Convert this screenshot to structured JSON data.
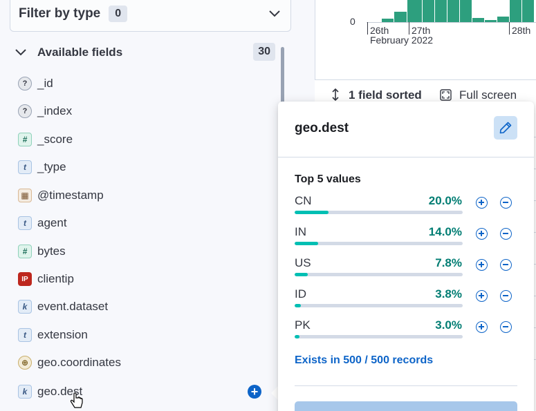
{
  "sidebar": {
    "filter": {
      "label": "Filter by type",
      "count": "0"
    },
    "available": {
      "title": "Available fields",
      "count": "30"
    },
    "fields": [
      {
        "name": "_id",
        "type": "unknown",
        "icon_text": "?"
      },
      {
        "name": "_index",
        "type": "unknown",
        "icon_text": "?"
      },
      {
        "name": "_score",
        "type": "number",
        "icon_text": "#"
      },
      {
        "name": "_type",
        "type": "string",
        "icon_text": "t"
      },
      {
        "name": "@timestamp",
        "type": "date",
        "icon_text": "▦"
      },
      {
        "name": "agent",
        "type": "string",
        "icon_text": "t"
      },
      {
        "name": "bytes",
        "type": "number",
        "icon_text": "#"
      },
      {
        "name": "clientip",
        "type": "ip",
        "icon_text": "IP"
      },
      {
        "name": "event.dataset",
        "type": "keyword",
        "icon_text": "k"
      },
      {
        "name": "extension",
        "type": "string",
        "icon_text": "t"
      },
      {
        "name": "geo.coordinates",
        "type": "geo",
        "icon_text": "⊕"
      },
      {
        "name": "geo.dest",
        "type": "keyword",
        "icon_text": "k"
      }
    ],
    "add_button": "+"
  },
  "histogram": {
    "zero_label": "0",
    "x_labels": [
      "26th",
      "27th",
      "28th"
    ],
    "month_label": "February 2022"
  },
  "toolbar": {
    "sort_label": "1 field sorted",
    "fullscreen_label": "Full screen"
  },
  "popover": {
    "title": "geo.dest",
    "section_title": "Top 5 values",
    "values": [
      {
        "label": "CN",
        "percent": "20.0%",
        "fraction": 0.2
      },
      {
        "label": "IN",
        "percent": "14.0%",
        "fraction": 0.14
      },
      {
        "label": "US",
        "percent": "7.8%",
        "fraction": 0.078
      },
      {
        "label": "ID",
        "percent": "3.8%",
        "fraction": 0.038
      },
      {
        "label": "PK",
        "percent": "3.0%",
        "fraction": 0.03
      }
    ],
    "exists_text": "Exists in 500 / 500 records"
  },
  "colors": {
    "accent": "#0d64c8",
    "bar": "#2d9f7e",
    "percent": "#017d73",
    "progress": "#00bfb3"
  }
}
